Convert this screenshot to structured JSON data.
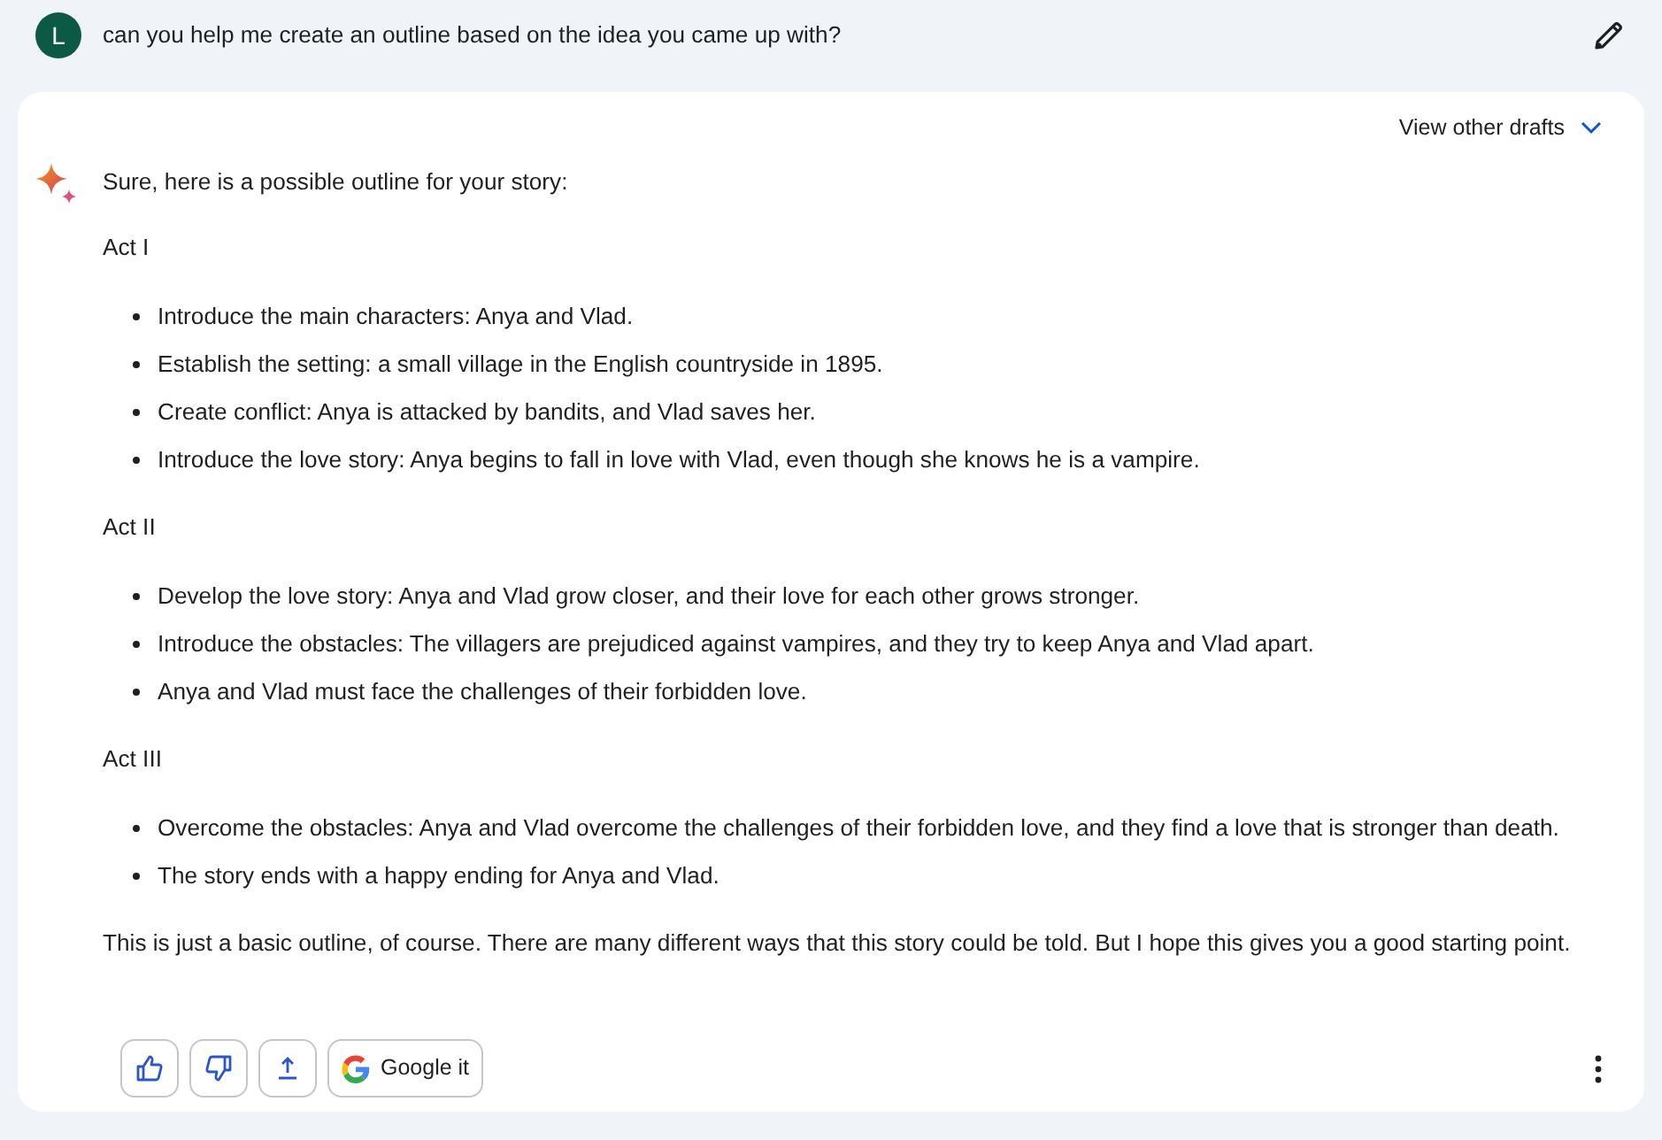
{
  "prompt": {
    "avatar_letter": "L",
    "text": "can you help me create an outline based on the idea you came up with?"
  },
  "response": {
    "drafts_link": "View other drafts",
    "blocks": [
      {
        "kind": "paragraph",
        "text": "Sure, here is a possible outline for your story:"
      },
      {
        "kind": "heading",
        "text": "Act I"
      },
      {
        "kind": "bullets",
        "items": [
          "Introduce the main characters: Anya and Vlad.",
          "Establish the setting: a small village in the English countryside in 1895.",
          "Create conflict: Anya is attacked by bandits, and Vlad saves her.",
          "Introduce the love story: Anya begins to fall in love with Vlad, even though she knows he is a vampire."
        ]
      },
      {
        "kind": "heading",
        "text": "Act II"
      },
      {
        "kind": "bullets",
        "items": [
          "Develop the love story: Anya and Vlad grow closer, and their love for each other grows stronger.",
          "Introduce the obstacles: The villagers are prejudiced against vampires, and they try to keep Anya and Vlad apart.",
          "Anya and Vlad must face the challenges of their forbidden love."
        ]
      },
      {
        "kind": "heading",
        "text": "Act III"
      },
      {
        "kind": "bullets",
        "items": [
          "Overcome the obstacles: Anya and Vlad overcome the challenges of their forbidden love, and they find a love that is stronger than death.",
          "The story ends with a happy ending for Anya and Vlad."
        ]
      },
      {
        "kind": "paragraph",
        "text": "This is just a basic outline, of course. There are many different ways that this story could be told. But I hope this gives you a good starting point."
      }
    ],
    "actions": [
      {
        "kind": "thumbs_up"
      },
      {
        "kind": "thumbs_down"
      },
      {
        "kind": "share"
      },
      {
        "kind": "google",
        "label": "Google it"
      }
    ]
  }
}
